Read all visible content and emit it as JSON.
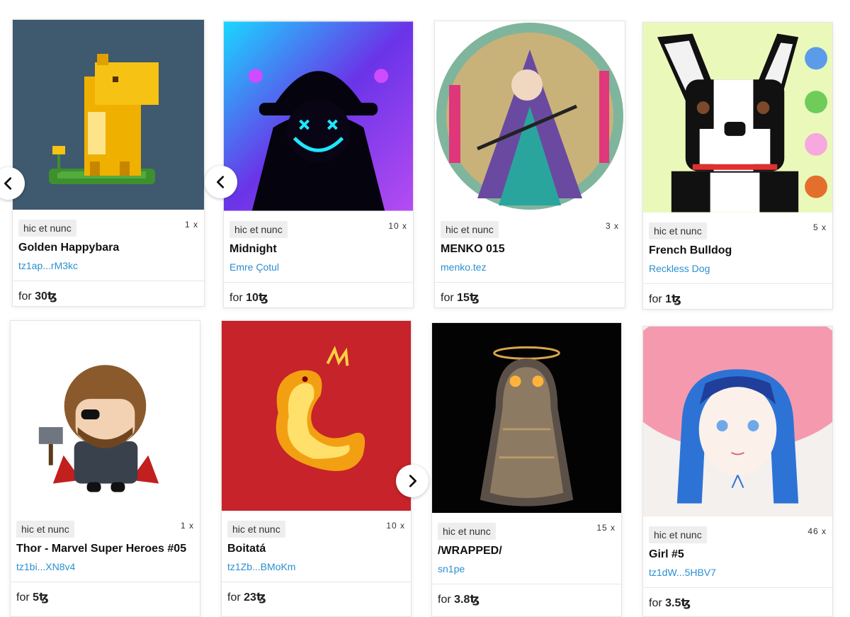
{
  "cards": [
    {
      "marketplace": "hic et nunc",
      "editions": "1 x",
      "title": "Golden Happybara",
      "creator": "tz1ap...rM3kc",
      "price_prefix": "for",
      "price": "30",
      "currency": "ꜩ",
      "artwork_icon": "capybara-pixel-art"
    },
    {
      "marketplace": "hic et nunc",
      "editions": "10 x",
      "title": "Midnight",
      "creator": "Emre Çotul",
      "price_prefix": "for",
      "price": "10",
      "currency": "ꜩ",
      "artwork_icon": "hooded-figure-neon-art"
    },
    {
      "marketplace": "hic et nunc",
      "editions": "3 x",
      "title": "MENKO 015",
      "creator": "menko.tez",
      "price_prefix": "for",
      "price": "15",
      "currency": "ꜩ",
      "artwork_icon": "samurai-circle-art"
    },
    {
      "marketplace": "hic et nunc",
      "editions": "5 x",
      "title": "French Bulldog",
      "creator": "Reckless Dog",
      "price_prefix": "for",
      "price": "1",
      "currency": "ꜩ",
      "artwork_icon": "bulldog-pixel-art"
    },
    {
      "marketplace": "hic et nunc",
      "editions": "1 x",
      "title": "Thor - Marvel Super Heroes #05",
      "creator": "tz1bi...XN8v4",
      "price_prefix": "for",
      "price": "5",
      "currency": "ꜩ",
      "artwork_icon": "thor-chibi-art"
    },
    {
      "marketplace": "hic et nunc",
      "editions": "10 x",
      "title": "Boitatá",
      "creator": "tz1Zb...BMoKm",
      "price_prefix": "for",
      "price": "23",
      "currency": "ꜩ",
      "artwork_icon": "fire-serpent-art"
    },
    {
      "marketplace": "hic et nunc",
      "editions": "15 x",
      "title": "/WRAPPED/",
      "creator": "sn1pe",
      "price_prefix": "for",
      "price": "3.8",
      "currency": "ꜩ",
      "artwork_icon": "ghost-halo-art"
    },
    {
      "marketplace": "hic et nunc",
      "editions": "46 x",
      "title": "Girl #5",
      "creator": "tz1dW...5HBV7",
      "price_prefix": "for",
      "price": "3.5",
      "currency": "ꜩ",
      "artwork_icon": "girl-pink-hat-art"
    }
  ],
  "navigation": {
    "prev_icon": "chevron-left-icon",
    "next_icon": "chevron-right-icon"
  },
  "colors": {
    "link": "#2a8fcf",
    "badge_bg": "#eeeeee"
  }
}
